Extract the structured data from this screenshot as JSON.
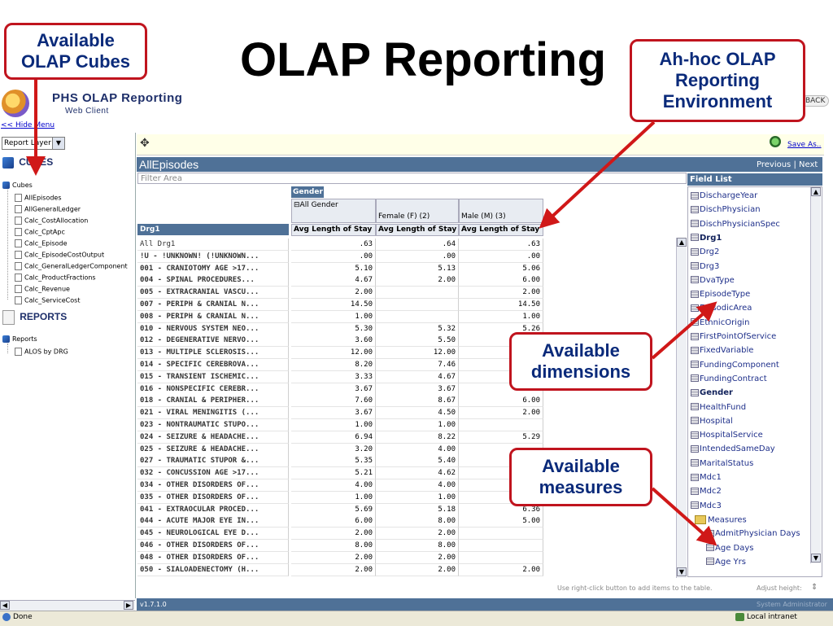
{
  "slide": {
    "title": "OLAP Reporting"
  },
  "callouts": {
    "cubes": [
      "Available",
      "OLAP Cubes"
    ],
    "adhoc": [
      "Ah-hoc OLAP",
      "Reporting",
      "Environment"
    ],
    "dimensions": [
      "Available",
      "dimensions"
    ],
    "measures": [
      "Available",
      "measures"
    ]
  },
  "app": {
    "name": "PHS OLAP Reporting",
    "subtitle": "Web Client",
    "back": "BACK",
    "hide_menu": "<< Hide Menu",
    "save_as": "Save As..",
    "report_name": "AllEpisodes",
    "prev_next": "Previous | Next",
    "filter_placeholder": "Filter Area",
    "footer_hint": "Use right-click button to add items to the table.",
    "adjust_height": "Adjust height:",
    "version": "v1.7.1.0",
    "user": "System Administrator",
    "status": "Done",
    "zone": "Local intranet"
  },
  "left": {
    "layer_select": "Report Layer",
    "cubes_head": "CUBES",
    "cubes_root": "Cubes",
    "cubes": [
      "AllEpisodes",
      "AllGeneralLedger",
      "Calc_CostAllocation",
      "Calc_CptApc",
      "Calc_Episode",
      "Calc_EpisodeCostOutput",
      "Calc_GeneralLedgerComponent",
      "Calc_ProductFractions",
      "Calc_Revenue",
      "Calc_ServiceCost"
    ],
    "reports_head": "REPORTS",
    "reports_root": "Reports",
    "reports": [
      "ALOS by DRG"
    ]
  },
  "pivot": {
    "col_dim": "Gender",
    "row_dim": "Drg1",
    "col_members": [
      "All Gender",
      "Female (F) (2)",
      "Male (M) (3)"
    ],
    "measure": "Avg Length of Stay",
    "rows": [
      {
        "label": "All Drg1",
        "v": [
          ".63",
          ".64",
          ".63"
        ]
      },
      {
        "label": "!U - !UNKNOWN! (!UNKNOWN...",
        "v": [
          ".00",
          ".00",
          ".00"
        ]
      },
      {
        "label": "001 - CRANIOTOMY AGE >17...",
        "v": [
          "5.10",
          "5.13",
          "5.06"
        ]
      },
      {
        "label": "004 - SPINAL PROCEDURES...",
        "v": [
          "4.67",
          "2.00",
          "6.00"
        ]
      },
      {
        "label": "005 - EXTRACRANIAL VASCU...",
        "v": [
          "2.00",
          "",
          "2.00"
        ]
      },
      {
        "label": "007 - PERIPH & CRANIAL N...",
        "v": [
          "14.50",
          "",
          "14.50"
        ]
      },
      {
        "label": "008 - PERIPH & CRANIAL N...",
        "v": [
          "1.00",
          "",
          "1.00"
        ]
      },
      {
        "label": "010 - NERVOUS SYSTEM NEO...",
        "v": [
          "5.30",
          "5.32",
          "5.26"
        ]
      },
      {
        "label": "012 - DEGENERATIVE NERVO...",
        "v": [
          "3.60",
          "5.50",
          ""
        ]
      },
      {
        "label": "013 - MULTIPLE SCLEROSIS...",
        "v": [
          "12.00",
          "12.00",
          ""
        ]
      },
      {
        "label": "014 - SPECIFIC CEREBROVA...",
        "v": [
          "8.20",
          "7.46",
          ""
        ]
      },
      {
        "label": "015 - TRANSIENT ISCHEMIC...",
        "v": [
          "3.33",
          "4.67",
          ""
        ]
      },
      {
        "label": "016 - NONSPECIFIC CEREBR...",
        "v": [
          "3.67",
          "3.67",
          ""
        ]
      },
      {
        "label": "018 - CRANIAL & PERIPHER...",
        "v": [
          "7.60",
          "8.67",
          "6.00"
        ]
      },
      {
        "label": "021 - VIRAL MENINGITIS (...",
        "v": [
          "3.67",
          "4.50",
          "2.00"
        ]
      },
      {
        "label": "023 - NONTRAUMATIC STUPO...",
        "v": [
          "1.00",
          "1.00",
          ""
        ]
      },
      {
        "label": "024 - SEIZURE & HEADACHE...",
        "v": [
          "6.94",
          "8.22",
          "5.29"
        ]
      },
      {
        "label": "025 - SEIZURE & HEADACHE...",
        "v": [
          "3.20",
          "4.00",
          ""
        ]
      },
      {
        "label": "027 - TRAUMATIC STUPOR &...",
        "v": [
          "5.35",
          "5.40",
          ""
        ]
      },
      {
        "label": "032 - CONCUSSION AGE >17...",
        "v": [
          "5.21",
          "4.62",
          ""
        ]
      },
      {
        "label": "034 - OTHER DISORDERS OF...",
        "v": [
          "4.00",
          "4.00",
          ""
        ]
      },
      {
        "label": "035 - OTHER DISORDERS OF...",
        "v": [
          "1.00",
          "1.00",
          ""
        ]
      },
      {
        "label": "041 - EXTRAOCULAR PROCED...",
        "v": [
          "5.69",
          "5.18",
          "6.36"
        ]
      },
      {
        "label": "044 - ACUTE MAJOR EYE IN...",
        "v": [
          "6.00",
          "8.00",
          "5.00"
        ]
      },
      {
        "label": "045 - NEUROLOGICAL EYE D...",
        "v": [
          "2.00",
          "2.00",
          ""
        ]
      },
      {
        "label": "046 - OTHER DISORDERS OF...",
        "v": [
          "8.00",
          "8.00",
          ""
        ]
      },
      {
        "label": "048 - OTHER DISORDERS OF...",
        "v": [
          "2.00",
          "2.00",
          ""
        ]
      },
      {
        "label": "050 - SIALOADENECTOMY (H...",
        "v": [
          "2.00",
          "2.00",
          "2.00"
        ]
      }
    ]
  },
  "field_list": {
    "title": "Field List",
    "fields": [
      {
        "name": "DischargeYear",
        "bold": false
      },
      {
        "name": "DischPhysician",
        "bold": false
      },
      {
        "name": "DischPhysicianSpec",
        "bold": false
      },
      {
        "name": "Drg1",
        "bold": true
      },
      {
        "name": "Drg2",
        "bold": false
      },
      {
        "name": "Drg3",
        "bold": false
      },
      {
        "name": "DvaType",
        "bold": false
      },
      {
        "name": "EpisodeType",
        "bold": false
      },
      {
        "name": "EpisodicArea",
        "bold": false
      },
      {
        "name": "EthnicOrigin",
        "bold": false
      },
      {
        "name": "FirstPointOfService",
        "bold": false
      },
      {
        "name": "FixedVariable",
        "bold": false
      },
      {
        "name": "FundingComponent",
        "bold": false
      },
      {
        "name": "FundingContract",
        "bold": false
      },
      {
        "name": "Gender",
        "bold": true
      },
      {
        "name": "HealthFund",
        "bold": false
      },
      {
        "name": "Hospital",
        "bold": false
      },
      {
        "name": "HospitalService",
        "bold": false
      },
      {
        "name": "IntendedSameDay",
        "bold": false
      },
      {
        "name": "MaritalStatus",
        "bold": false
      },
      {
        "name": "Mdc1",
        "bold": false
      },
      {
        "name": "Mdc2",
        "bold": false
      },
      {
        "name": "Mdc3",
        "bold": false
      }
    ],
    "measures_folder": "Measures",
    "measures": [
      "AdmitPhysician Days",
      "Age Days",
      "Age Yrs"
    ]
  },
  "colors": {
    "accent": "#4f7197",
    "callout_border": "#c0141e",
    "callout_text": "#0a2a7a",
    "arrow": "#d01818"
  }
}
